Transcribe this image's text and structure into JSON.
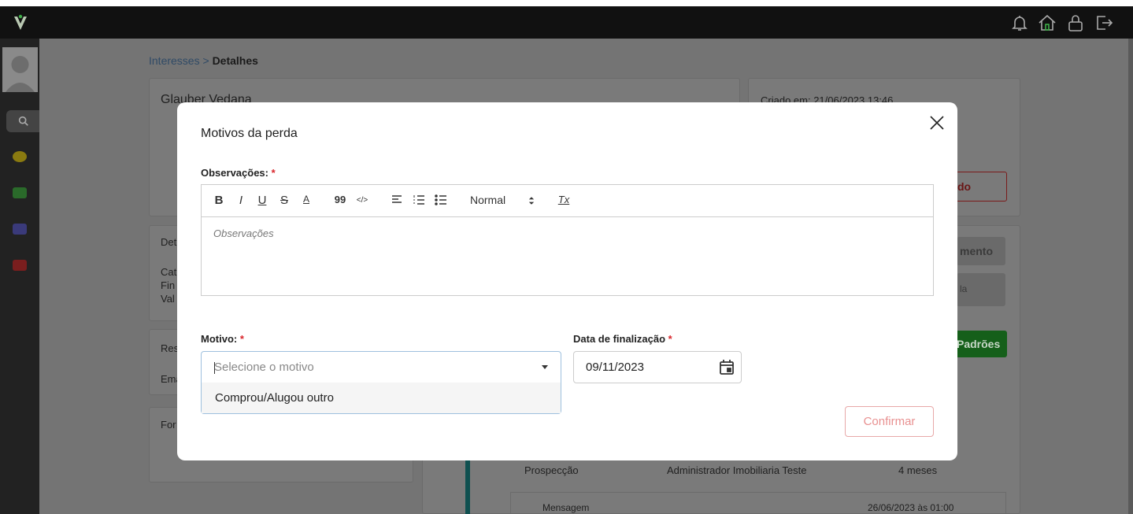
{
  "header": {
    "logo": "V",
    "icons": [
      "bell-icon",
      "home-icon",
      "lock-icon",
      "logout-icon"
    ]
  },
  "sidebar": {
    "icons": [
      "search-icon",
      "dashboard-icon",
      "building-icon",
      "users-icon",
      "dollar-icon"
    ]
  },
  "background": {
    "breadcrumb_link": "Interesses",
    "breadcrumb_sep": ">",
    "breadcrumb_current": "Detalhes",
    "client_name": "Glauber Vedana",
    "created_at": "Criado em: 21/06/2023 13:46",
    "card_labels": [
      "Det",
      "Cat",
      "Fin",
      "Val",
      "Res",
      "Ema",
      "For"
    ],
    "stage": "Prospecção",
    "agent": "Administrador Imobiliaria Teste",
    "duration": "4 meses",
    "message_label": "Mensagem",
    "message_time": "26/06/2023 às 01:00",
    "btn_padroes": "Padrões",
    "btn_mento": "mento",
    "btn_la": "la",
    "btn_do": "do"
  },
  "modal": {
    "title": "Motivos da perda",
    "observacoes_label": "Observações:",
    "required_mark": "*",
    "editor_placeholder": "Observações",
    "toolbar": {
      "bold": "B",
      "italic": "I",
      "underline": "U",
      "strike": "S",
      "color": "A",
      "quote": "99",
      "code": "</>",
      "header_select": "Normal",
      "clean": "Tx"
    },
    "motivo_label": "Motivo:",
    "motivo_placeholder": "Selecione o motivo",
    "motivo_options": [
      "Comprou/Alugou outro"
    ],
    "data_label": "Data de finalização",
    "data_value": "09/11/2023",
    "confirm_label": "Confirmar"
  }
}
